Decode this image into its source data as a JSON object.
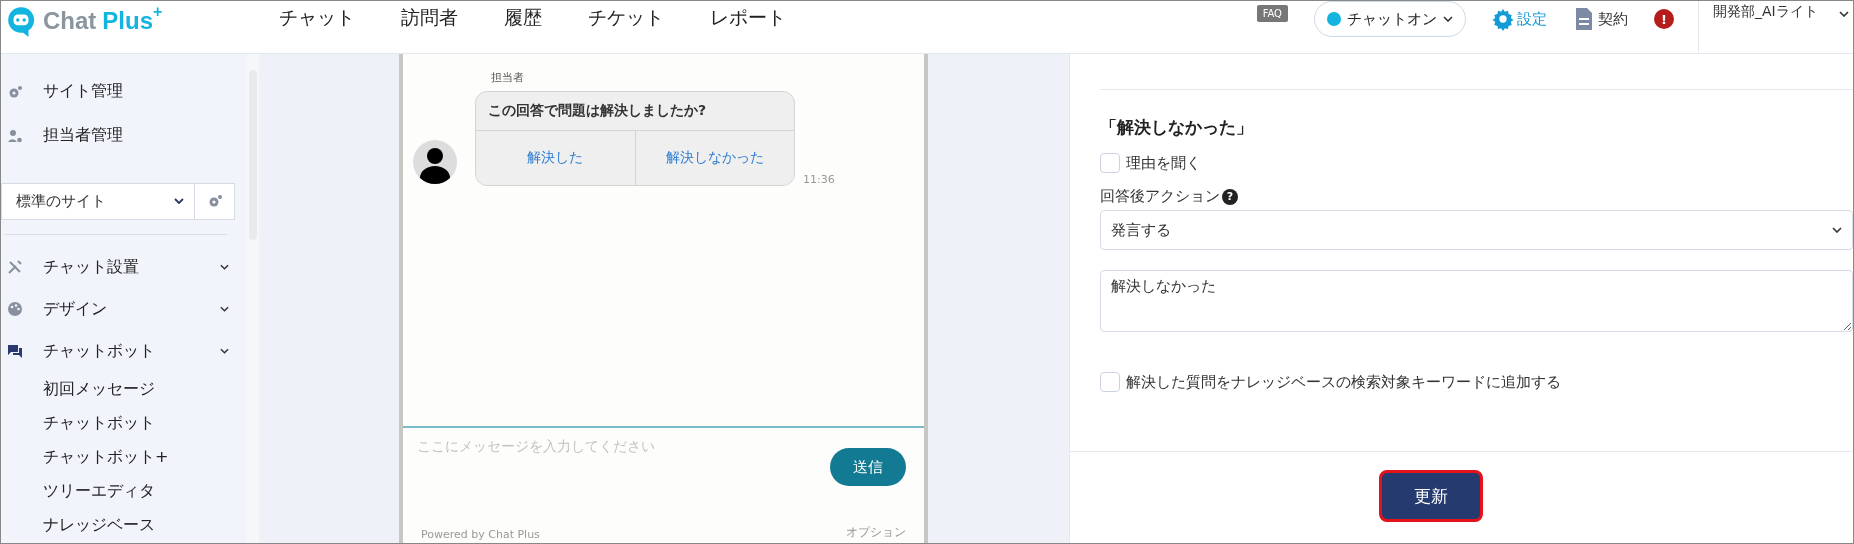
{
  "header": {
    "logo": {
      "word1": "Chat",
      "word2": "Plus",
      "mark": "+"
    },
    "nav": [
      "チャット",
      "訪問者",
      "履歴",
      "チケット",
      "レポート"
    ],
    "faq": "FAQ",
    "status": {
      "label": "チャットオン",
      "color": "#13b5e0"
    },
    "settings": "設定",
    "contract": "契約",
    "alert": "!",
    "user": "開発部_AIライト"
  },
  "sidebar": {
    "admin_items": [
      {
        "label": "サイト管理"
      },
      {
        "label": "担当者管理"
      }
    ],
    "site_select": "標準のサイト",
    "groups": [
      {
        "label": "チャット設置"
      },
      {
        "label": "デザイン"
      },
      {
        "label": "チャットボット"
      }
    ],
    "sub_items": [
      "初回メッセージ",
      "チャットボット",
      "チャットボット+",
      "ツリーエディタ",
      "ナレッジベース"
    ]
  },
  "chat": {
    "agent": "担当者",
    "question": "この回答で問題は解決しましたか?",
    "options": [
      "解決した",
      "解決しなかった"
    ],
    "time": "11:36",
    "placeholder": "ここにメッセージを入力してください",
    "send": "送信",
    "powered": "Powered by Chat Plus",
    "option_link": "オプション"
  },
  "form": {
    "heading": "「解決しなかった」",
    "ask_reason": {
      "label": "理由を聞く",
      "checked": false
    },
    "action_label": "回答後アクション",
    "help": "?",
    "action_value": "発言する",
    "message": "解決しなかった",
    "add_keyword": {
      "label": "解決した質問をナレッジベースの検索対象キーワードに追加する",
      "checked": false
    },
    "update": "更新"
  }
}
